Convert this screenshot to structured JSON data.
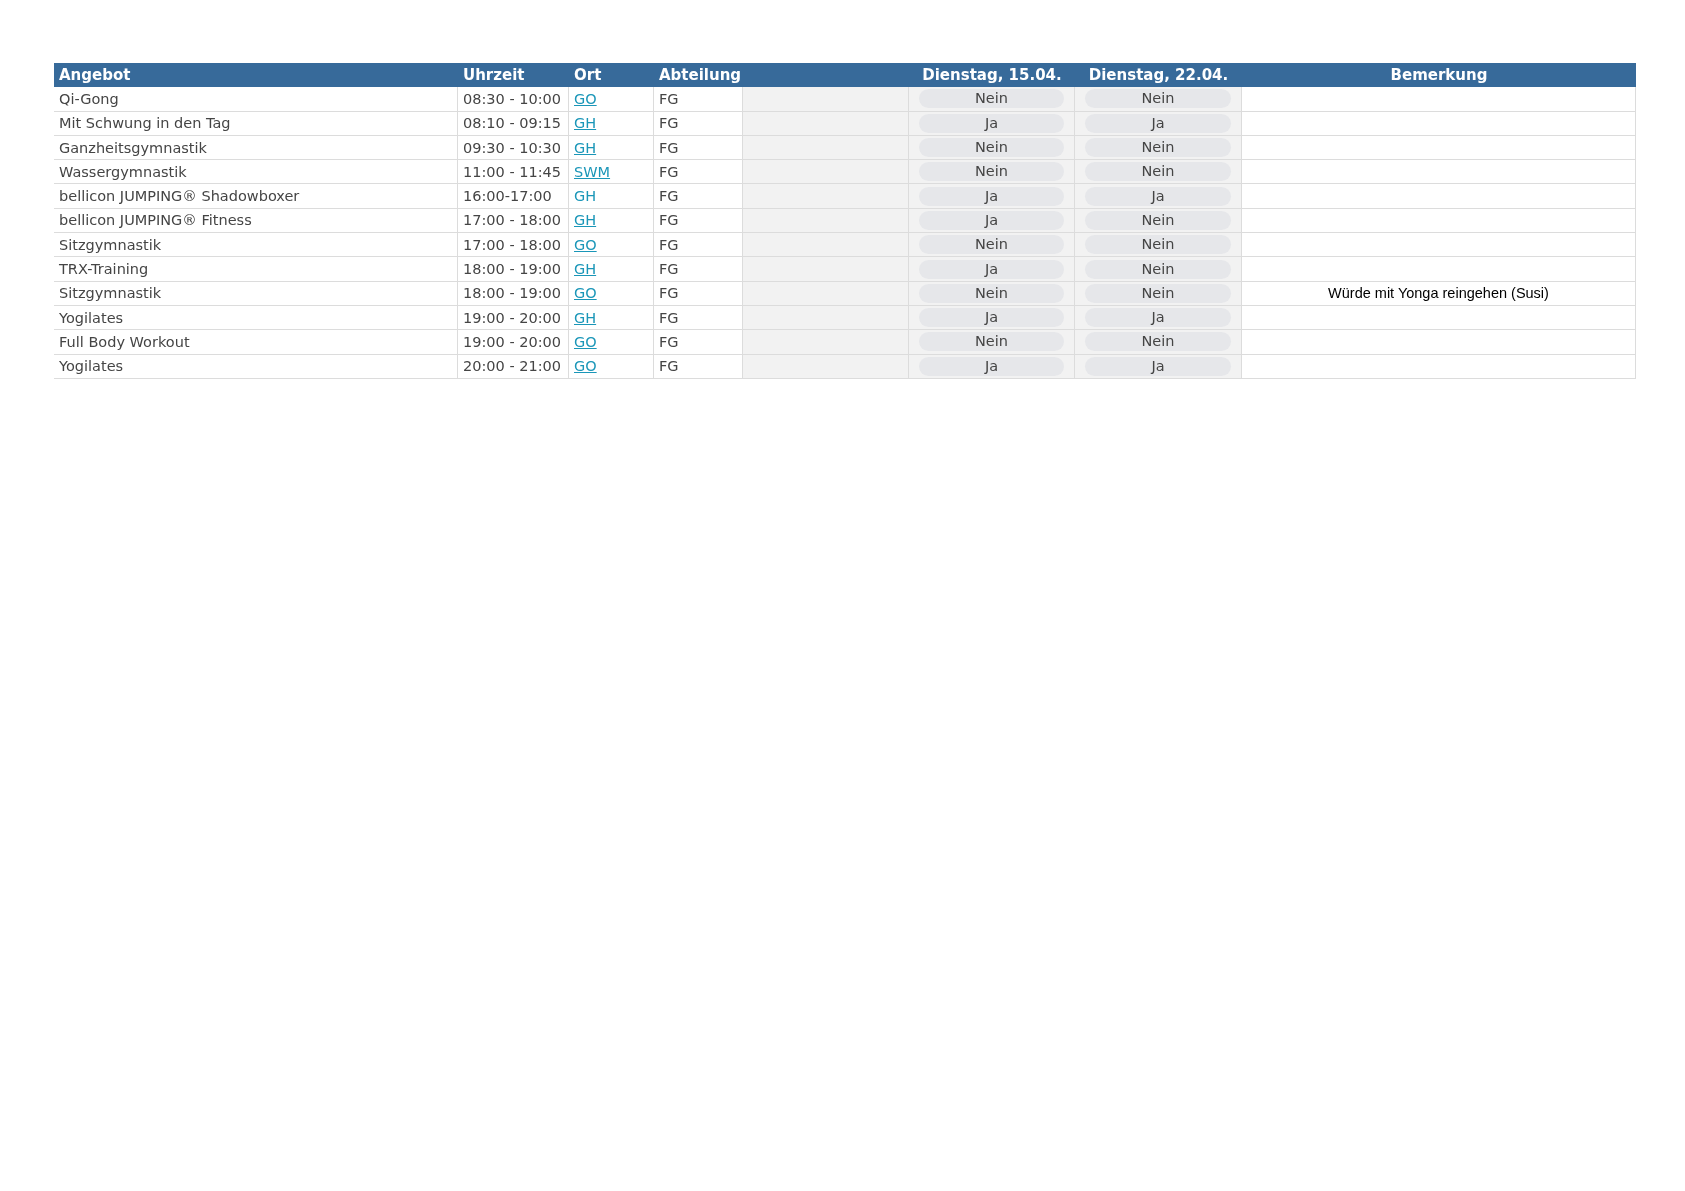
{
  "table": {
    "columns": [
      "Angebot",
      "Uhrzeit",
      "Ort",
      "Abteilung",
      "",
      "Dienstag, 15.04.",
      "Dienstag, 22.04.",
      "Bemerkung"
    ],
    "rows": [
      {
        "angebot": "Qi-Gong",
        "uhrzeit": "08:30 - 10:00",
        "ort": "GO",
        "ort_underlined": true,
        "abteilung": "FG",
        "tag_1": "Nein",
        "tag_2": "Nein"
      },
      {
        "angebot": "Mit Schwung in den Tag",
        "uhrzeit": "08:10 - 09:15",
        "ort": "GH",
        "ort_underlined": true,
        "abteilung": "FG",
        "tag_1": "Ja",
        "tag_2": "Ja"
      },
      {
        "angebot": "Ganzheitsgymnastik",
        "uhrzeit": "09:30 - 10:30",
        "ort": "GH",
        "ort_underlined": true,
        "abteilung": "FG",
        "tag_1": "Nein",
        "tag_2": "Nein"
      },
      {
        "angebot": "Wassergymnastik",
        "uhrzeit": "11:00 - 11:45",
        "ort": "SWM",
        "ort_underlined": true,
        "abteilung": "FG",
        "tag_1": "Nein",
        "tag_2": "Nein"
      },
      {
        "angebot": "bellicon JUMPING® Shadowboxer",
        "uhrzeit": "16:00-17:00",
        "ort": "GH",
        "ort_underlined": false,
        "abteilung": "FG",
        "tag_1": "Ja",
        "tag_2": "Ja"
      },
      {
        "angebot": "bellicon JUMPING® Fitness",
        "uhrzeit": "17:00 - 18:00",
        "ort": "GH",
        "ort_underlined": true,
        "abteilung": "FG",
        "tag_1": "Ja",
        "tag_2": "Nein"
      },
      {
        "angebot": "Sitzgymnastik",
        "uhrzeit": "17:00 - 18:00",
        "ort": "GO",
        "ort_underlined": true,
        "abteilung": "FG",
        "tag_1": "Nein",
        "tag_2": "Nein"
      },
      {
        "angebot": "TRX-Training",
        "uhrzeit": "18:00 - 19:00",
        "ort": "GH",
        "ort_underlined": true,
        "abteilung": "FG",
        "tag_1": "Ja",
        "tag_2": "Nein"
      },
      {
        "angebot": "Sitzgymnastik",
        "uhrzeit": "18:00 - 19:00",
        "ort": "GO",
        "ort_underlined": true,
        "abteilung": "FG",
        "tag_1": "Nein",
        "tag_2": "Nein",
        "bemerkung": "Würde mit Yonga reingehen (Susi)"
      },
      {
        "angebot": "Yogilates",
        "uhrzeit": "19:00 - 20:00",
        "ort": "GH",
        "ort_underlined": true,
        "abteilung": "FG",
        "tag_1": "Ja",
        "tag_2": "Ja"
      },
      {
        "angebot": "Full Body Workout",
        "uhrzeit": "19:00 - 20:00",
        "ort": "GO",
        "ort_underlined": true,
        "abteilung": "FG",
        "tag_1": "Nein",
        "tag_2": "Nein"
      },
      {
        "angebot": "Yogilates",
        "uhrzeit": "20:00 - 21:00",
        "ort": "GO",
        "ort_underlined": true,
        "abteilung": "FG",
        "tag_1": "Ja",
        "tag_2": "Ja"
      }
    ]
  }
}
